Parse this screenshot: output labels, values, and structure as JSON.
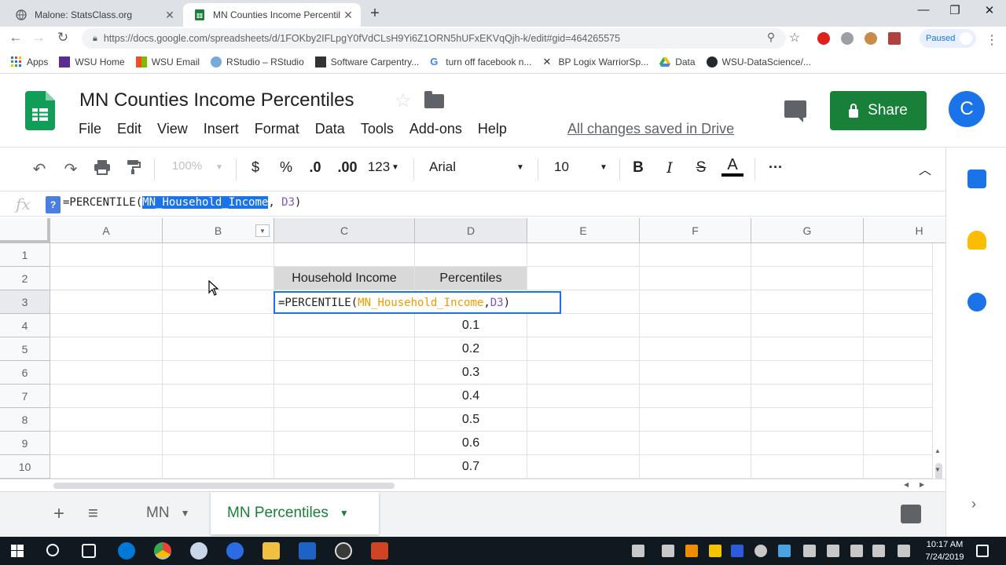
{
  "browser": {
    "tabs": [
      {
        "title": "Malone: StatsClass.org",
        "active": false
      },
      {
        "title": "MN Counties Income Percentiles",
        "active": true
      }
    ],
    "url": "https://docs.google.com/spreadsheets/d/1FOKby2IFLpgY0fVdCLsH9Yi6Z1ORN5hUFxEKVqQjh-k/edit#gid=464265575",
    "profile_status": "Paused",
    "bookmarks": [
      "Apps",
      "WSU Home",
      "WSU Email",
      "RStudio – RStudio",
      "Software Carpentry...",
      "turn off facebook n...",
      "BP Logix WarriorSp...",
      "Data",
      "WSU-DataScience/..."
    ]
  },
  "doc": {
    "title": "MN Counties Income Percentiles",
    "menu": [
      "File",
      "Edit",
      "View",
      "Insert",
      "Format",
      "Data",
      "Tools",
      "Add-ons",
      "Help"
    ],
    "saved_status": "All changes saved in Drive",
    "share_label": "Share",
    "avatar_letter": "C"
  },
  "toolbar": {
    "zoom": "100%",
    "currency": "$",
    "percent": "%",
    "dec_less": ".0",
    "dec_more": ".00",
    "more_formats": "123",
    "font": "Arial",
    "font_size": "10",
    "bold": "B",
    "italic": "I",
    "strike": "S",
    "text_color": "A",
    "more": "···"
  },
  "formula_bar": {
    "fx": "fx",
    "help": "?",
    "prefix": "=PERCENTILE(",
    "range": "MN_Household_Income",
    "sep": ", ",
    "ref": "D3",
    "suffix": ")"
  },
  "grid": {
    "columns": [
      "A",
      "B",
      "C",
      "D",
      "E",
      "F",
      "G",
      "H"
    ],
    "rows": [
      "1",
      "2",
      "3",
      "4",
      "5",
      "6",
      "7",
      "8",
      "9",
      "10"
    ],
    "header_c2": "Household Income",
    "header_d2": "Percentiles",
    "percentiles": [
      "0.1",
      "0.2",
      "0.3",
      "0.4",
      "0.5",
      "0.6",
      "0.7"
    ]
  },
  "sheets": {
    "tabs": [
      "MN",
      "MN Percentiles"
    ],
    "active": "MN Percentiles"
  },
  "taskbar": {
    "time": "10:17 AM",
    "date": "7/24/2019"
  },
  "colors": {
    "sheets_green": "#188038",
    "selection_blue": "#1a73e8",
    "range_orange": "#f29900",
    "ref_purple": "#7e57c2"
  }
}
